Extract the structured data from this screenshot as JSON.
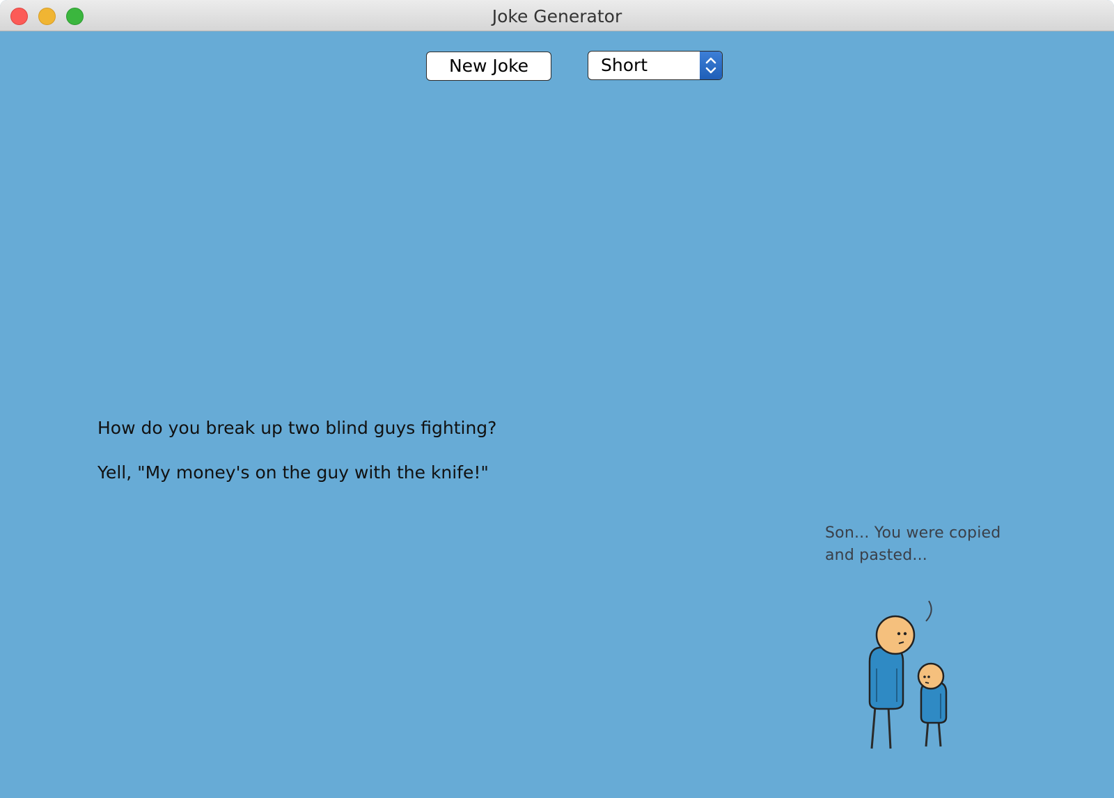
{
  "window": {
    "title": "Joke Generator"
  },
  "toolbar": {
    "new_joke_label": "New Joke",
    "length_select": {
      "selected": "Short"
    }
  },
  "joke": {
    "setup": "How do you break up two blind guys fighting?",
    "punchline": "Yell, \"My money's on the guy with the knife!\""
  },
  "comic": {
    "caption_line1": "Son... You were copied",
    "caption_line2": "and pasted..."
  },
  "colors": {
    "background": "#67abd6",
    "figure_body": "#2f8ac4",
    "figure_skin": "#f5c07d"
  }
}
